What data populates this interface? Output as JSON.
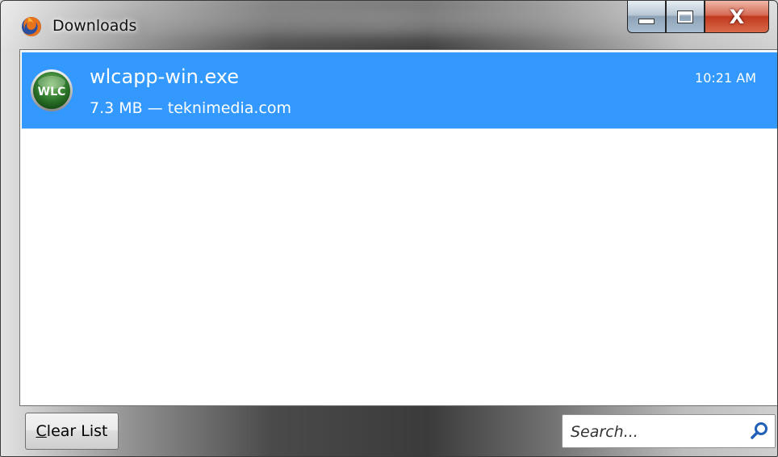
{
  "window": {
    "title": "Downloads",
    "controls": {
      "minimize": "minimize",
      "maximize": "maximize",
      "close": "X"
    }
  },
  "downloads": [
    {
      "icon_text": "WLC",
      "name": "wlcapp-win.exe",
      "status": "7.3 MB — teknimedia.com",
      "time": "10:21 AM",
      "selected": true
    }
  ],
  "footer": {
    "clear_list_accel": "C",
    "clear_list_rest": "lear List",
    "search_placeholder": "Search..."
  },
  "colors": {
    "selection": "#3399ff",
    "close_button": "#c2391f"
  }
}
